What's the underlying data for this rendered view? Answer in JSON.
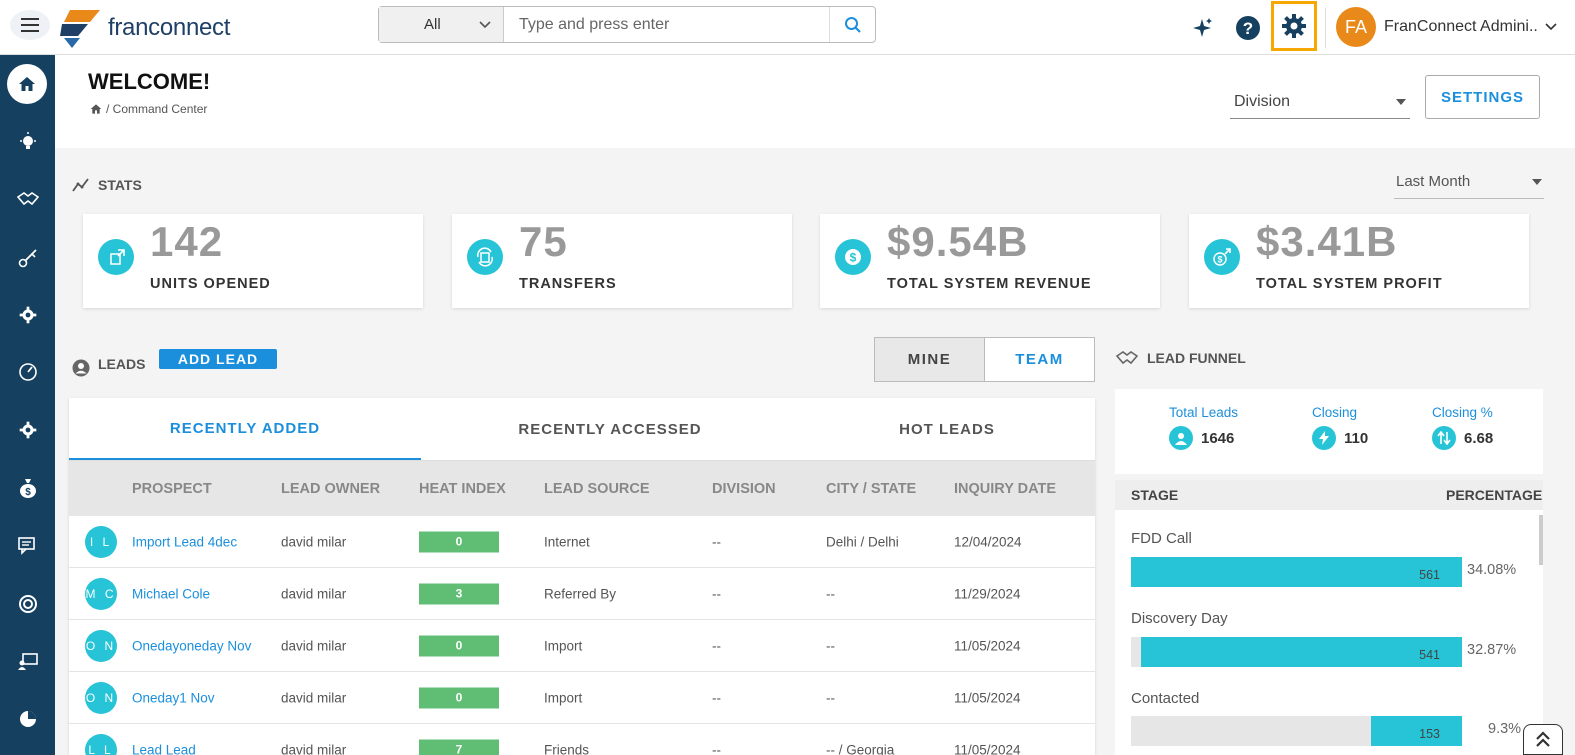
{
  "header": {
    "search": {
      "scope": "All",
      "placeholder": "Type and press enter"
    },
    "user": {
      "initials": "FA",
      "name": "FranConnect Admini..."
    },
    "logo_text": "franconnect"
  },
  "welcome": {
    "title": "WELCOME!",
    "breadcrumb": "/ Command Center",
    "division_label": "Division",
    "settings_label": "SETTINGS"
  },
  "stats": {
    "label": "STATS",
    "period": "Last Month",
    "cards": [
      {
        "value": "142",
        "label": "UNITS OPENED"
      },
      {
        "value": "75",
        "label": "TRANSFERS"
      },
      {
        "value": "$9.54B",
        "label": "TOTAL SYSTEM REVENUE"
      },
      {
        "value": "$3.41B",
        "label": "TOTAL SYSTEM PROFIT"
      }
    ]
  },
  "leads": {
    "label": "LEADS",
    "add_lead": "ADD LEAD",
    "toggle": {
      "mine": "MINE",
      "team": "TEAM"
    },
    "tabs": [
      "RECENTLY ADDED",
      "RECENTLY ACCESSED",
      "HOT LEADS"
    ],
    "columns": [
      "PROSPECT",
      "LEAD OWNER",
      "HEAT INDEX",
      "LEAD SOURCE",
      "DIVISION",
      "CITY / STATE",
      "INQUIRY DATE"
    ],
    "rows": [
      {
        "initials": "I L",
        "prospect": "Import Lead 4dec",
        "owner": "david milar",
        "heat": "0",
        "source": "Internet",
        "division": "--",
        "city": "Delhi / Delhi",
        "date": "12/04/2024"
      },
      {
        "initials": "M C",
        "prospect": "Michael Cole",
        "owner": "david milar",
        "heat": "3",
        "source": "Referred By",
        "division": "--",
        "city": "--",
        "date": "11/29/2024"
      },
      {
        "initials": "O N",
        "prospect": "Onedayoneday Nov",
        "owner": "david milar",
        "heat": "0",
        "source": "Import",
        "division": "--",
        "city": "--",
        "date": "11/05/2024"
      },
      {
        "initials": "O N",
        "prospect": "Oneday1 Nov",
        "owner": "david milar",
        "heat": "0",
        "source": "Import",
        "division": "--",
        "city": "--",
        "date": "11/05/2024"
      },
      {
        "initials": "L L",
        "prospect": "Lead Lead",
        "owner": "david milar",
        "heat": "7",
        "source": "Friends",
        "division": "--",
        "city": "-- / Georgia",
        "date": "11/05/2024"
      }
    ]
  },
  "funnel": {
    "label": "LEAD FUNNEL",
    "summary": [
      {
        "title": "Total Leads",
        "value": "1646"
      },
      {
        "title": "Closing",
        "value": "110"
      },
      {
        "title": "Closing %",
        "value": "6.68"
      }
    ],
    "stage_header": "STAGE",
    "percentage_header": "PERCENTAGE",
    "stages": [
      {
        "name": "FDD Call",
        "count": "561",
        "pct": "34.08%",
        "share": 0.3408
      },
      {
        "name": "Discovery Day",
        "count": "541",
        "pct": "32.87%",
        "share": 0.3287
      },
      {
        "name": "Contacted",
        "count": "153",
        "pct": "9.3%",
        "share": 0.093
      }
    ]
  },
  "colors": {
    "accent": "#1b8fdc",
    "teal": "#26c4d6",
    "sidebar": "#16405f",
    "highlight": "#f6a800",
    "heat": "#5fbd74"
  }
}
